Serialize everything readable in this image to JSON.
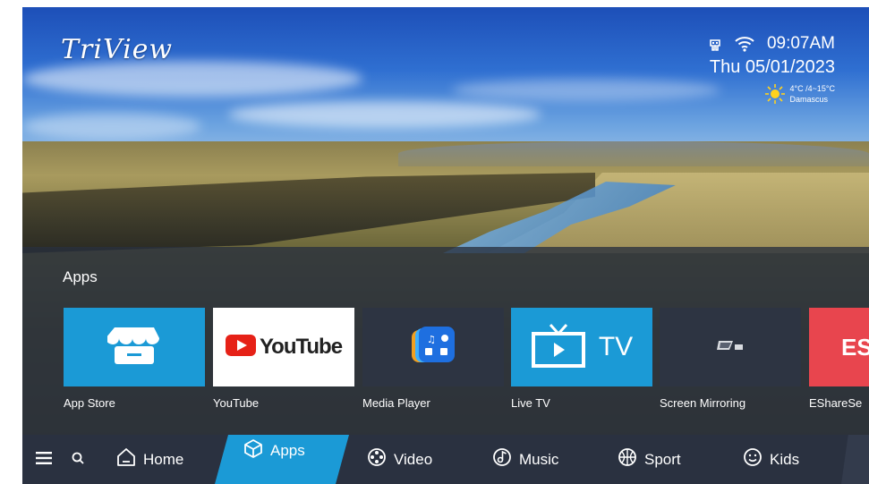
{
  "brand": {
    "logo_text": "TriView"
  },
  "status": {
    "time": "09:07AM",
    "date": "Thu 05/01/2023",
    "weather_temp": "4°C /4~15°C",
    "weather_city": "Damascus",
    "icons": [
      "usb-icon",
      "wifi-icon",
      "sun-icon"
    ]
  },
  "apps_section": {
    "title": "Apps"
  },
  "apps": [
    {
      "label": "App Store",
      "color": "#1b9ad6"
    },
    {
      "label": "YouTube",
      "color": "#ffffff",
      "logo_text": "YouTube"
    },
    {
      "label": "Media Player",
      "color": "#2d3442"
    },
    {
      "label": "Live TV",
      "color": "#1b9ad6",
      "logo_text": "TV"
    },
    {
      "label": "Screen Mirroring",
      "color": "#2d3442"
    },
    {
      "label": "EShareSe",
      "color": "#e8454e",
      "logo_text": "ES"
    }
  ],
  "nav": {
    "menu_icon": "menu-icon",
    "search_icon": "search-icon",
    "items": [
      {
        "label": "Home",
        "icon": "home-icon"
      },
      {
        "label": "Apps",
        "icon": "cube-icon",
        "active": true
      },
      {
        "label": "Video",
        "icon": "film-reel-icon"
      },
      {
        "label": "Music",
        "icon": "music-icon"
      },
      {
        "label": "Sport",
        "icon": "ball-icon"
      },
      {
        "label": "Kids",
        "icon": "smiley-icon"
      }
    ]
  },
  "colors": {
    "accent": "#1b9ad6",
    "nav_bg": "#2a3140",
    "youtube_red": "#e62117"
  }
}
